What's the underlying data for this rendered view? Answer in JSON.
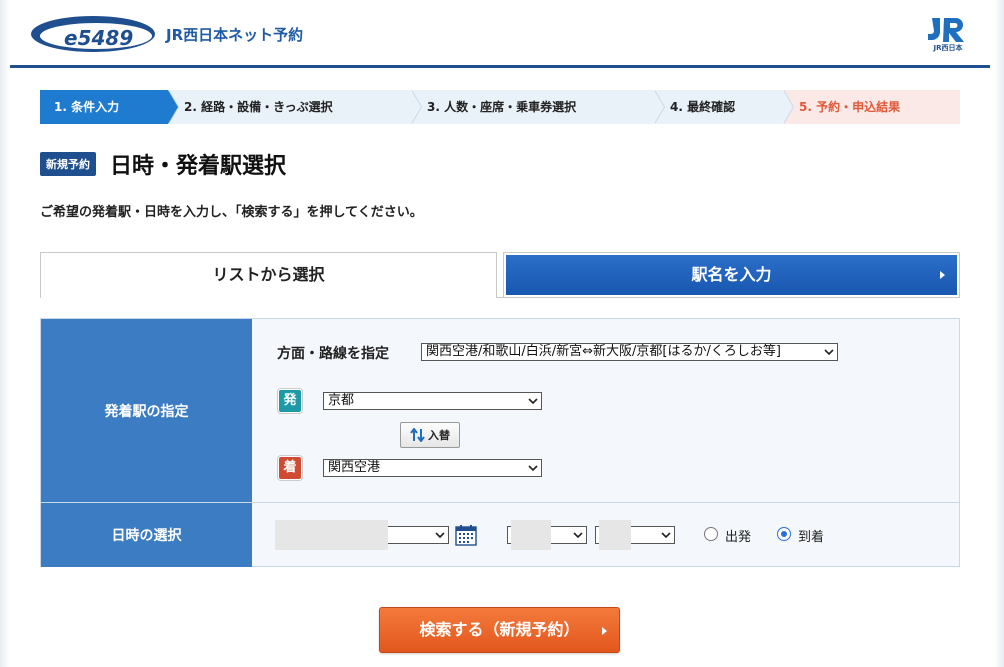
{
  "header": {
    "logo_text": "e5489",
    "site_title": "JR西日本ネット予約",
    "corp_logo_text": "JR西日本"
  },
  "steps": [
    {
      "label": "1. 条件入力"
    },
    {
      "label": "2. 経路・設備・きっぷ選択"
    },
    {
      "label": "3. 人数・座席・乗車券選択"
    },
    {
      "label": "4. 最終確認"
    },
    {
      "label": "5. 予約・申込結果"
    }
  ],
  "heading": {
    "badge": "新規予約",
    "title": "日時・発着駅選択",
    "instruction": "ご希望の発着駅・日時を入力し、「検索する」を押してください。"
  },
  "tabs": {
    "list": "リストから選択",
    "station": "駅名を入力"
  },
  "form": {
    "station_row_label": "発着駅の指定",
    "route_label": "方面・路線を指定",
    "route_value": "関西空港/和歌山/白浜/新宮⇔新大阪/京都[はるか/くろしお等]",
    "dep_badge": "発",
    "dep_value": "京都",
    "swap_label": "入替",
    "arr_badge": "着",
    "arr_value": "関西空港",
    "datetime_row_label": "日時の選択",
    "radio_dep_label": "出発",
    "radio_arr_label": "到着",
    "selected_mode": "到着"
  },
  "search_button": "検索する（新規予約）",
  "colors": {
    "brand_blue": "#1f4f8f",
    "active_step": "#1f7bd0",
    "label_cell": "#3b7cc2",
    "search_orange": "#e2571d",
    "dep_teal": "#1d9aa8",
    "arr_red": "#d04b33"
  }
}
